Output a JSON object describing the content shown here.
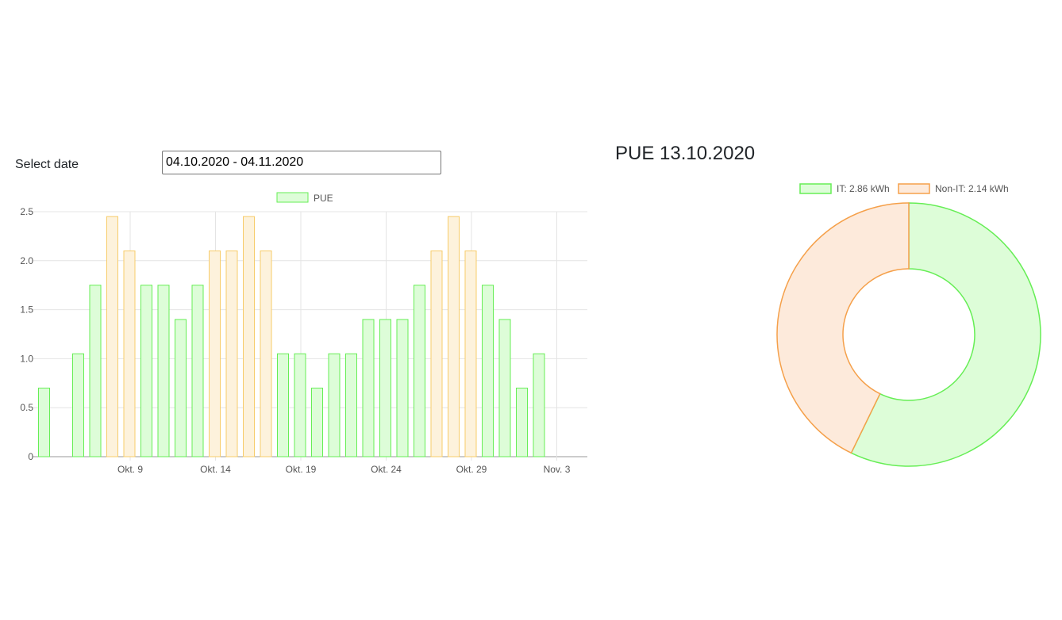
{
  "date_picker": {
    "label": "Select date",
    "value": "04.10.2020 - 04.11.2020"
  },
  "pie": {
    "title": "PUE 13.10.2020"
  },
  "colors": {
    "green_stroke": "#66ee55",
    "green_fill": "#ddfdd8",
    "orange_stroke": "#f7cc6a",
    "orange_fill": "#fdf2dc",
    "pie_orange_stroke": "#f5a04a",
    "pie_orange_fill": "#fdeadb"
  },
  "chart_data": [
    {
      "type": "bar",
      "legend": [
        "PUE"
      ],
      "legend_position": "top",
      "x_tick_labels": [
        "Okt. 9",
        "Okt. 14",
        "Okt. 19",
        "Okt. 24",
        "Okt. 29",
        "Nov. 3"
      ],
      "y_tick_labels": [
        "0",
        "0.5",
        "1.0",
        "1.5",
        "2.0",
        "2.5"
      ],
      "ylim": [
        0,
        2.5
      ],
      "grid": true,
      "series": [
        {
          "name": "PUE",
          "dates": [
            "Okt. 4",
            "Okt. 5",
            "Okt. 6",
            "Okt. 7",
            "Okt. 8",
            "Okt. 9",
            "Okt. 10",
            "Okt. 11",
            "Okt. 12",
            "Okt. 13",
            "Okt. 14",
            "Okt. 15",
            "Okt. 16",
            "Okt. 17",
            "Okt. 18",
            "Okt. 19",
            "Okt. 20",
            "Okt. 21",
            "Okt. 22",
            "Okt. 23",
            "Okt. 24",
            "Okt. 25",
            "Okt. 26",
            "Okt. 27",
            "Okt. 28",
            "Okt. 29",
            "Okt. 30",
            "Okt. 31",
            "Nov. 1",
            "Nov. 2",
            "Nov. 3"
          ],
          "values": [
            0.7,
            0,
            1.05,
            1.75,
            2.45,
            2.1,
            1.75,
            1.75,
            1.4,
            1.75,
            2.1,
            2.1,
            2.45,
            2.1,
            1.05,
            1.05,
            0.7,
            1.05,
            1.05,
            1.4,
            1.4,
            1.4,
            1.75,
            2.1,
            2.45,
            2.1,
            1.75,
            1.4,
            0.7,
            1.05,
            null
          ],
          "bar_colors": [
            "green",
            "none",
            "green",
            "green",
            "orange",
            "orange",
            "green",
            "green",
            "green",
            "green",
            "orange",
            "orange",
            "orange",
            "orange",
            "green",
            "green",
            "green",
            "green",
            "green",
            "green",
            "green",
            "green",
            "green",
            "orange",
            "orange",
            "orange",
            "green",
            "green",
            "green",
            "green",
            "none"
          ]
        }
      ]
    },
    {
      "type": "pie",
      "style": "doughnut",
      "legend_position": "top",
      "slices": [
        {
          "name": "IT: 2.86 kWh",
          "value": 2.86,
          "color": "green"
        },
        {
          "name": "Non-IT: 2.14 kWh",
          "value": 2.14,
          "color": "orange"
        }
      ]
    }
  ]
}
